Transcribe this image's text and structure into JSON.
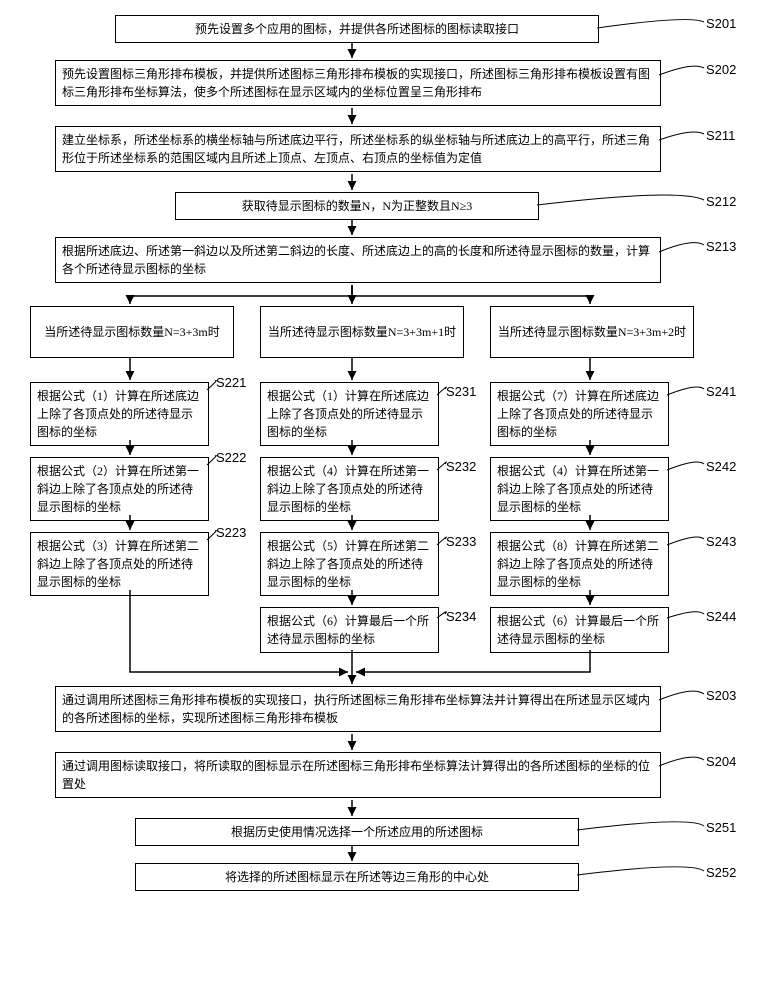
{
  "boxes": {
    "s201": "预先设置多个应用的图标，并提供各所述图标的图标读取接口",
    "s202": "预先设置图标三角形排布模板，并提供所述图标三角形排布模板的实现接口，所述图标三角形排布模板设置有图标三角形排布坐标算法，使多个所述图标在显示区域内的坐标位置呈三角形排布",
    "s211": "建立坐标系，所述坐标系的横坐标轴与所述底边平行，所述坐标系的纵坐标轴与所述底边上的高平行，所述三角形位于所述坐标系的范围区域内且所述上顶点、左顶点、右顶点的坐标值为定值",
    "s212": "获取待显示图标的数量N，N为正整数且N≥3",
    "s213": "根据所述底边、所述第一斜边以及所述第二斜边的长度、所述底边上的高的长度和所述待显示图标的数量，计算各个所述待显示图标的坐标",
    "branchL": "当所述待显示图标数量N=3+3m时",
    "branchM": "当所述待显示图标数量N=3+3m+1时",
    "branchR": "当所述待显示图标数量N=3+3m+2时",
    "s221": "根据公式（1）计算在所述底边上除了各顶点处的所述待显示图标的坐标",
    "s222": "根据公式（2）计算在所述第一斜边上除了各顶点处的所述待显示图标的坐标",
    "s223": "根据公式（3）计算在所述第二斜边上除了各顶点处的所述待显示图标的坐标",
    "s231": "根据公式（1）计算在所述底边上除了各顶点处的所述待显示图标的坐标",
    "s232": "根据公式（4）计算在所述第一斜边上除了各顶点处的所述待显示图标的坐标",
    "s233": "根据公式（5）计算在所述第二斜边上除了各顶点处的所述待显示图标的坐标",
    "s234": "根据公式（6）计算最后一个所述待显示图标的坐标",
    "s241": "根据公式（7）计算在所述底边上除了各顶点处的所述待显示图标的坐标",
    "s242": "根据公式（4）计算在所述第一斜边上除了各顶点处的所述待显示图标的坐标",
    "s243": "根据公式（8）计算在所述第二斜边上除了各顶点处的所述待显示图标的坐标",
    "s244": "根据公式（6）计算最后一个所述待显示图标的坐标",
    "s203": "通过调用所述图标三角形排布模板的实现接口，执行所述图标三角形排布坐标算法并计算得出在所述显示区域内的各所述图标的坐标，实现所述图标三角形排布模板",
    "s204": "通过调用图标读取接口，将所读取的图标显示在所述图标三角形排布坐标算法计算得出的各所述图标的坐标的位置处",
    "s251": "根据历史使用情况选择一个所述应用的所述图标",
    "s252": "将选择的所述图标显示在所述等边三角形的中心处"
  },
  "labels": {
    "s201": "S201",
    "s202": "S202",
    "s211": "S211",
    "s212": "S212",
    "s213": "S213",
    "s221": "S221",
    "s222": "S222",
    "s223": "S223",
    "s231": "S231",
    "s232": "S232",
    "s233": "S233",
    "s234": "S234",
    "s241": "S241",
    "s242": "S242",
    "s243": "S243",
    "s244": "S244",
    "s203": "S203",
    "s204": "S204",
    "s251": "S251",
    "s252": "S252"
  }
}
